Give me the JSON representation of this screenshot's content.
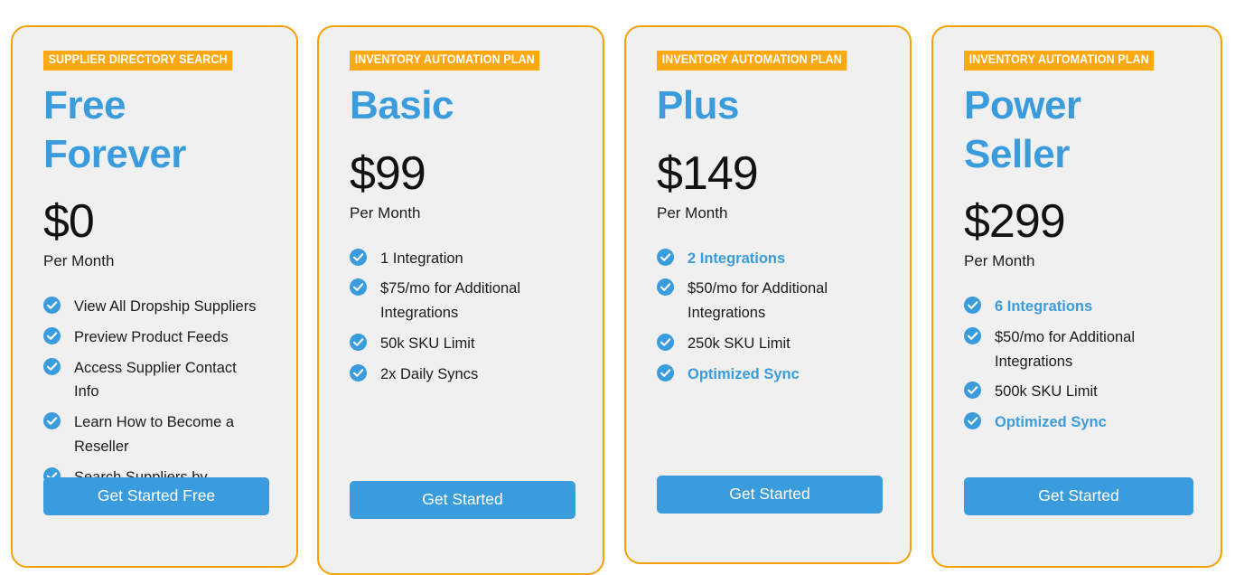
{
  "theme": {
    "accent_blue": "#3b9cdd",
    "badge_orange": "#ffa812",
    "card_border": "#f5a200",
    "card_background": "#f0f0f0",
    "page_background": "#ffffff",
    "text_color": "#1b1b1b"
  },
  "plans": [
    {
      "badge": "SUPPLIER DIRECTORY SEARCH",
      "name": "Free\nForever",
      "price": "$0",
      "period": "Per Month",
      "features": [
        {
          "text": "View All Dropship Suppliers",
          "highlight": false
        },
        {
          "text": "Preview Product Feeds",
          "highlight": false
        },
        {
          "text": "Access Supplier Contact Info",
          "highlight": false
        },
        {
          "text": "Learn How to Become a Reseller",
          "highlight": false
        },
        {
          "text": "Search Suppliers by Advanced Filters",
          "highlight": false
        }
      ],
      "cta_label": "Get Started Free"
    },
    {
      "badge": "INVENTORY AUTOMATION PLAN",
      "name": "Basic",
      "price": "$99",
      "period": "Per Month",
      "features": [
        {
          "text": "1 Integration",
          "highlight": false
        },
        {
          "text": "$75/mo for Additional Integrations",
          "highlight": false
        },
        {
          "text": "50k SKU Limit",
          "highlight": false
        },
        {
          "text": "2x Daily Syncs",
          "highlight": false
        }
      ],
      "cta_label": "Get Started"
    },
    {
      "badge": "INVENTORY AUTOMATION PLAN",
      "name": "Plus",
      "price": "$149",
      "period": "Per Month",
      "features": [
        {
          "text": "2 Integrations",
          "highlight": true
        },
        {
          "text": "$50/mo for Additional Integrations",
          "highlight": false
        },
        {
          "text": "250k SKU Limit",
          "highlight": false
        },
        {
          "text": "Optimized Sync",
          "highlight": true
        }
      ],
      "cta_label": "Get Started"
    },
    {
      "badge": "INVENTORY AUTOMATION PLAN",
      "name": "Power Seller",
      "price": "$299",
      "period": "Per Month",
      "features": [
        {
          "text": "6 Integrations",
          "highlight": true
        },
        {
          "text": "$50/mo for Additional Integrations",
          "highlight": false
        },
        {
          "text": "500k SKU Limit",
          "highlight": false
        },
        {
          "text": "Optimized Sync",
          "highlight": true
        }
      ],
      "cta_label": "Get Started"
    }
  ],
  "icons": {
    "check": "check-circle-icon"
  }
}
